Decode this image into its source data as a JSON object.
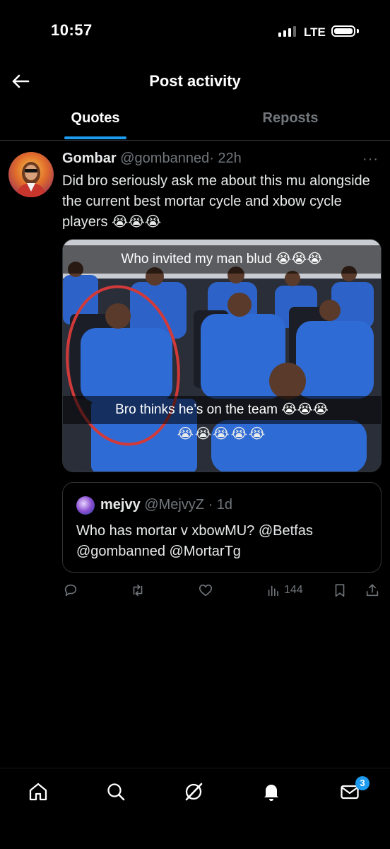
{
  "status_bar": {
    "time": "10:57",
    "network": "LTE"
  },
  "header": {
    "title": "Post activity"
  },
  "tabs": [
    {
      "label": "Quotes",
      "active": true
    },
    {
      "label": "Reposts",
      "active": false
    }
  ],
  "post": {
    "author_name": "Gombar",
    "author_handle": "@gombanned",
    "time": "· 22h",
    "more": "···",
    "text": "Did bro seriously ask me about this mu alongside the current best mortar cycle and xbow cycle players 😭😭😭",
    "image": {
      "caption_top": "Who invited my man blud 😭😭😭",
      "caption_bottom": "Bro thinks he’s on the team 😭😭😭",
      "caption_emojis": "😭😭😭😭😭"
    },
    "quoted": {
      "author_name": "mejvy",
      "author_handle": "@MejvyZ",
      "time": "· 1d",
      "text": "Who has mortar v xbowMU? @Betfas @gombanned @MortarTg"
    },
    "actions": {
      "views": "144",
      "icons": [
        "reply-icon",
        "repost-icon",
        "like-icon",
        "views-icon",
        "bookmark-icon",
        "share-icon"
      ]
    }
  },
  "bottom_nav": {
    "items": [
      "home-icon",
      "search-icon",
      "grok-icon",
      "notifications-icon",
      "messages-icon"
    ],
    "messages_badge": "3"
  },
  "colors": {
    "accent": "#1d9bf0",
    "muted": "#71767b",
    "background": "#000000",
    "text": "#e7e9ea"
  }
}
